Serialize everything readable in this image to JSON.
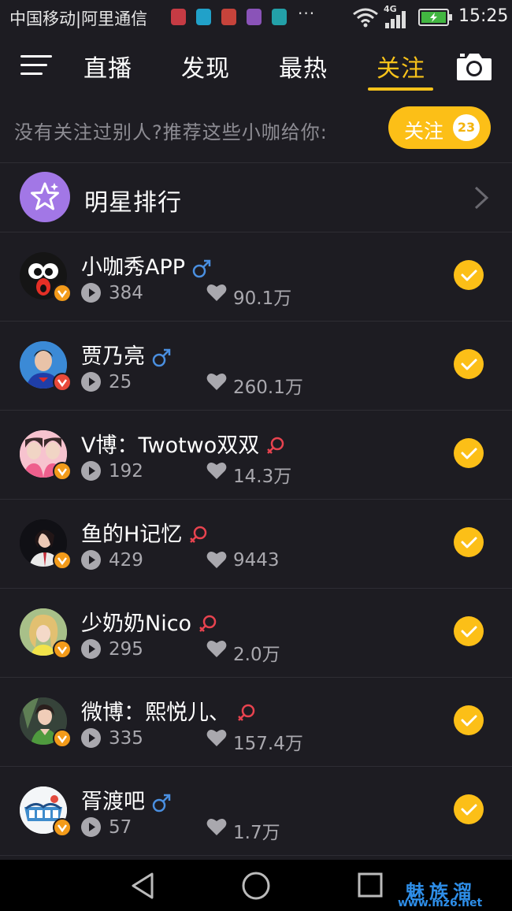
{
  "status_bar": {
    "carrier": "中国移动|阿里通信",
    "more": "···",
    "network": "4G",
    "time": "15:25"
  },
  "nav": {
    "tabs": [
      {
        "label": "直播"
      },
      {
        "label": "发现"
      },
      {
        "label": "最热"
      },
      {
        "label": "关注"
      }
    ],
    "active_tab": "关注",
    "accent_color": "#f7c21a"
  },
  "recommend": {
    "text": "没有关注过别人?推荐这些小咖给你:",
    "button_label": "关注",
    "button_count": "23"
  },
  "star_ranking": {
    "label": "明星排行"
  },
  "users": [
    {
      "name": "小咖秀APP",
      "gender": "male",
      "plays": "384",
      "likes": "90.1万",
      "followed": true
    },
    {
      "name": "贾乃亮",
      "gender": "male",
      "plays": "25",
      "likes": "260.1万",
      "followed": true
    },
    {
      "name": "V博：Twotwo双双",
      "gender": "female",
      "plays": "192",
      "likes": "14.3万",
      "followed": true
    },
    {
      "name": "鱼的H记忆",
      "gender": "female",
      "plays": "429",
      "likes": "9443",
      "followed": true
    },
    {
      "name": "少奶奶Nico",
      "gender": "female",
      "plays": "295",
      "likes": "2.0万",
      "followed": true
    },
    {
      "name": "微博：熙悦儿、",
      "gender": "female",
      "plays": "335",
      "likes": "157.4万",
      "followed": true
    },
    {
      "name": "胥渡吧",
      "gender": "male",
      "plays": "57",
      "likes": "1.7万",
      "followed": true
    }
  ],
  "watermark": {
    "top": "魅族溜",
    "bottom": "www.mz6.net"
  },
  "colors": {
    "background": "#1d1c22",
    "accent": "#fcbf17",
    "male": "#4a8fe0",
    "female": "#e8434f",
    "badge": "#f39b1a",
    "star_circle": "#a277e6"
  }
}
